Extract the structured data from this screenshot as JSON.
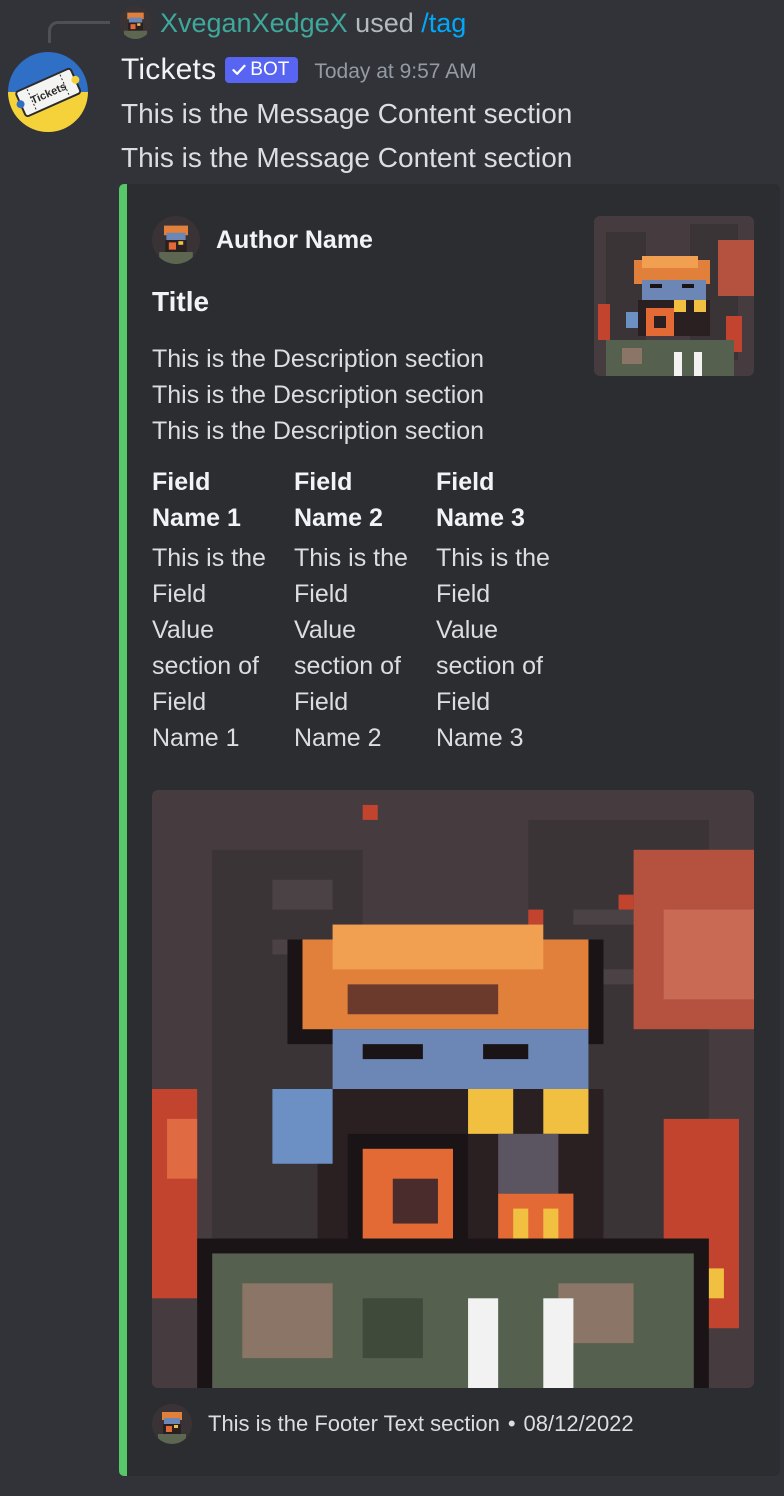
{
  "reply": {
    "username": "XveganXedgeX",
    "used": "used",
    "command": "/tag"
  },
  "message": {
    "bot_name": "Tickets",
    "bot_badge": "BOT",
    "timestamp": "Today at 9:57 AM",
    "content_lines": [
      "This is the Message Content section",
      "This is the Message Content section"
    ]
  },
  "bot_avatar": {
    "logo_text": "Tickets",
    "icon": "ticket-logo-icon"
  },
  "embed": {
    "accent_color": "#57c86a",
    "author_name": "Author Name",
    "title": "Title",
    "description_lines": [
      "This is the Description section",
      "This is the Description section",
      "This is the Description section"
    ],
    "fields": [
      {
        "name_lines": [
          "Field",
          "Name 1"
        ],
        "value_lines": [
          "This is the",
          "Field",
          "Value",
          "section of",
          "Field",
          "Name 1"
        ]
      },
      {
        "name_lines": [
          "Field",
          "Name 2"
        ],
        "value_lines": [
          "This is the",
          "Field",
          "Value",
          "section of",
          "Field",
          "Name 2"
        ]
      },
      {
        "name_lines": [
          "Field",
          "Name 3"
        ],
        "value_lines": [
          "This is the",
          "Field",
          "Value",
          "section of",
          "Field",
          "Name 3"
        ]
      }
    ],
    "footer_text": "This is the Footer Text section",
    "footer_separator": "•",
    "footer_date": "08/12/2022"
  },
  "colors": {
    "background": "#313338",
    "embed_background": "#2b2d31",
    "bot_badge": "#5865f2",
    "reply_username": "#3fa89c",
    "command_link": "#00a8fc"
  }
}
